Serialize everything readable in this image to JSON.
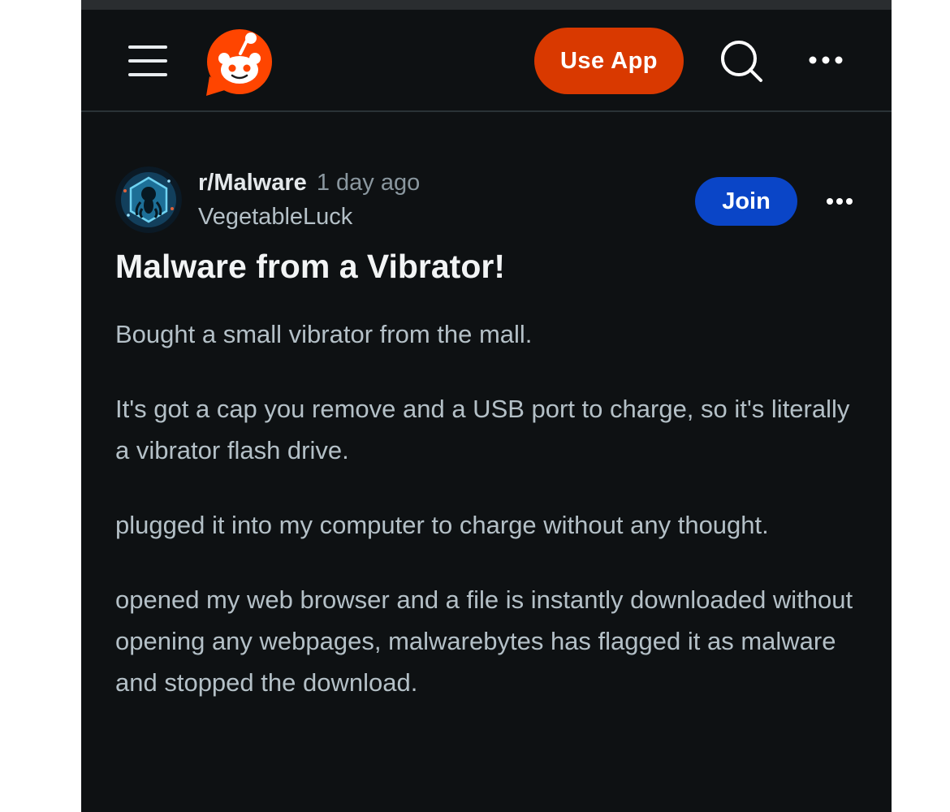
{
  "header": {
    "use_app_label": "Use App"
  },
  "post": {
    "subreddit": "r/Malware",
    "age": "1 day ago",
    "author": "VegetableLuck",
    "join_label": "Join",
    "title": "Malware from a Vibrator!",
    "paragraphs": [
      "Bought a small vibrator from the mall.",
      "It's got a cap you remove and a USB port to charge, so it's literally a vibrator flash drive.",
      "plugged it into my computer to charge without any thought.",
      "opened my web browser and a file is instantly downloaded without opening any webpages, malwarebytes has flagged it as malware and stopped the download."
    ]
  },
  "icons": {
    "menu": "hamburger-menu-icon",
    "logo": "reddit-logo-icon",
    "search": "search-icon",
    "more": "more-dots-icon",
    "avatar": "subreddit-avatar-icon"
  },
  "colors": {
    "background": "#0e1113",
    "accent_orange": "#d93900",
    "join_blue": "#0a45c7"
  }
}
